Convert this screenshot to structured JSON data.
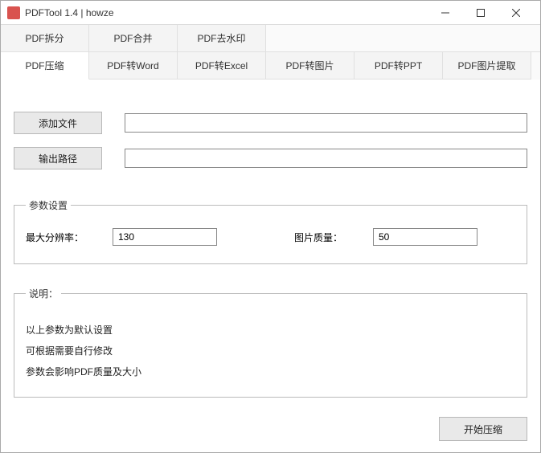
{
  "window": {
    "title": "PDFTool 1.4  |   howze"
  },
  "tabs_row1": [
    {
      "label": "PDF拆分"
    },
    {
      "label": "PDF合并"
    },
    {
      "label": "PDF去水印"
    }
  ],
  "tabs_row2": [
    {
      "label": "PDF压缩",
      "active": true
    },
    {
      "label": "PDF转Word"
    },
    {
      "label": "PDF转Excel"
    },
    {
      "label": "PDF转图片"
    },
    {
      "label": "PDF转PPT"
    },
    {
      "label": "PDF图片提取"
    }
  ],
  "buttons": {
    "add_file": "添加文件",
    "output_path": "输出路径",
    "start": "开始压缩"
  },
  "params": {
    "legend": "参数设置",
    "max_res_label": "最大分辨率：",
    "max_res_value": "130",
    "quality_label": "图片质量：",
    "quality_value": "50"
  },
  "description": {
    "legend": "说明：",
    "line1": "以上参数为默认设置",
    "line2": "可根据需要自行修改",
    "line3": "参数会影响PDF质量及大小"
  }
}
